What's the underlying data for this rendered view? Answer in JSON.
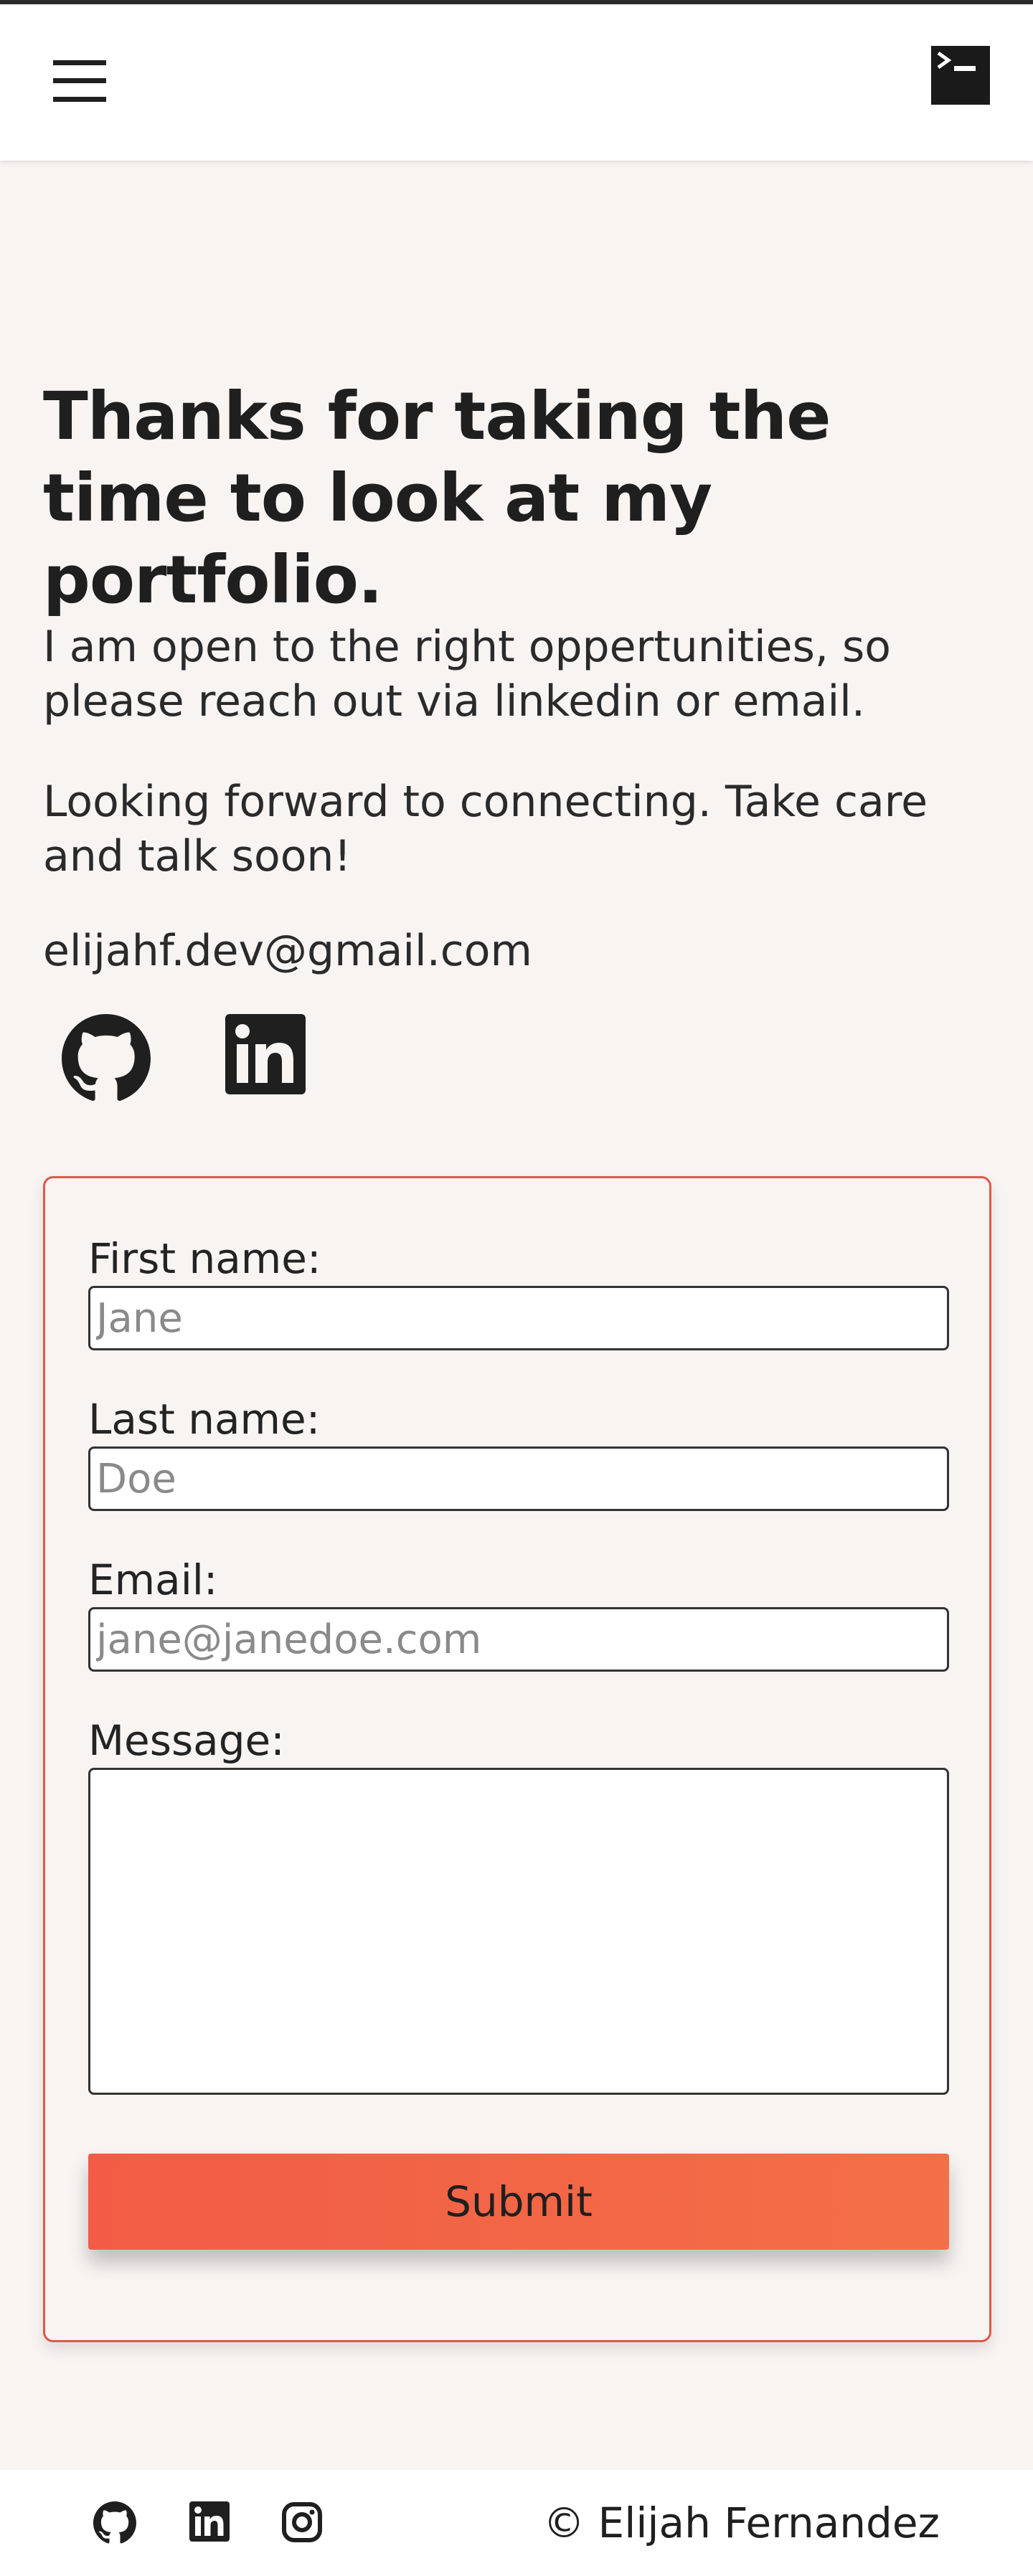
{
  "header": {
    "menu_icon": "hamburger-menu-icon",
    "logo_icon": "terminal-icon"
  },
  "main": {
    "heading": "Thanks for taking the time to look at my portfolio.",
    "paragraph_1": "I am open to the right oppertunities, so please reach out via linkedin or email.",
    "paragraph_2": "Looking forward to connecting. Take care and talk soon!",
    "email": "elijahf.dev@gmail.com",
    "social_icons": [
      "github-icon",
      "linkedin-icon"
    ]
  },
  "form": {
    "first_name_label": "First name:",
    "first_name_placeholder": "Jane",
    "last_name_label": "Last name:",
    "last_name_placeholder": "Doe",
    "email_label": "Email:",
    "email_placeholder": "jane@janedoe.com",
    "message_label": "Message:",
    "submit_label": "Submit"
  },
  "footer": {
    "icons": [
      "github-icon",
      "linkedin-icon",
      "instagram-icon"
    ],
    "copyright": "© Elijah Fernandez"
  },
  "colors": {
    "accent": "#f25c46",
    "form_border": "#e2574a",
    "background": "#f7f4f2",
    "text": "#1f1f1f"
  }
}
